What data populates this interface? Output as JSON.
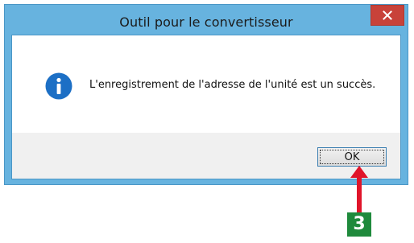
{
  "window": {
    "title": "Outil pour le convertisseur",
    "close_icon": "close-icon"
  },
  "dialog": {
    "icon": "info-icon",
    "message": "L'enregistrement de l'adresse de l'unité est un succès.",
    "ok_label": "OK"
  },
  "annotation": {
    "step_number": "3",
    "arrow_color": "#e0152a",
    "badge_color": "#1f8a3c"
  },
  "colors": {
    "titlebar": "#67b3df",
    "close_button": "#c8423a",
    "client_area": "#f0f0f0"
  }
}
